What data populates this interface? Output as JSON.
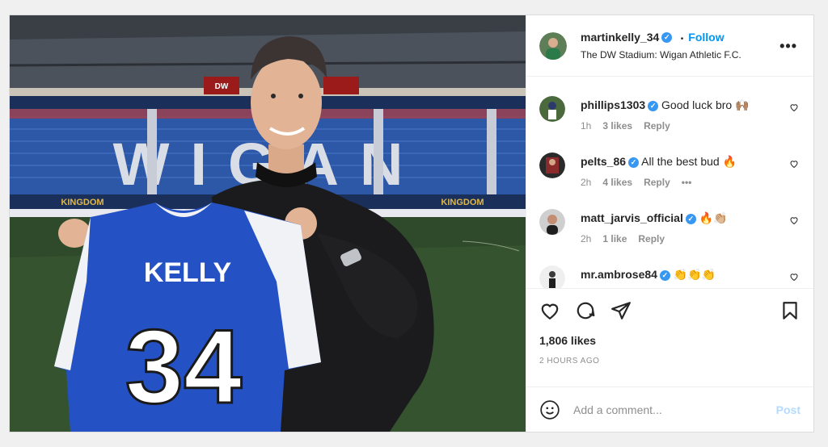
{
  "header": {
    "username": "martinkelly_34",
    "verified": true,
    "dot": "•",
    "follow_label": "Follow",
    "location": "The DW Stadium: Wigan Athletic F.C.",
    "more_icon": "more-horizontal-icon"
  },
  "photo": {
    "jersey_name": "KELLY",
    "jersey_number": "34",
    "stadium_letters": "WIGAN",
    "board_text": "KINGDOM",
    "sponsor_top": "DW"
  },
  "comments": [
    {
      "user": "phillips1303",
      "text": "Good luck bro 🙌🏽",
      "time": "1h",
      "likes": "3 likes",
      "reply": "Reply",
      "more": ""
    },
    {
      "user": "pelts_86",
      "text": "All the best bud 🔥",
      "time": "2h",
      "likes": "4 likes",
      "reply": "Reply",
      "more": "•••"
    },
    {
      "user": "matt_jarvis_official",
      "text": "🔥👏🏼",
      "time": "2h",
      "likes": "1 like",
      "reply": "Reply",
      "more": ""
    },
    {
      "user": "mr.ambrose84",
      "text": "👏👏👏",
      "time": "",
      "likes": "",
      "reply": "",
      "more": ""
    }
  ],
  "actions": {
    "likes": "1,806 likes",
    "timestamp": "2 HOURS AGO"
  },
  "add_comment": {
    "placeholder": "Add a comment...",
    "post_label": "Post"
  },
  "colors": {
    "accent": "#0095f6",
    "verified": "#3897f0",
    "muted": "#8e8e8e"
  }
}
